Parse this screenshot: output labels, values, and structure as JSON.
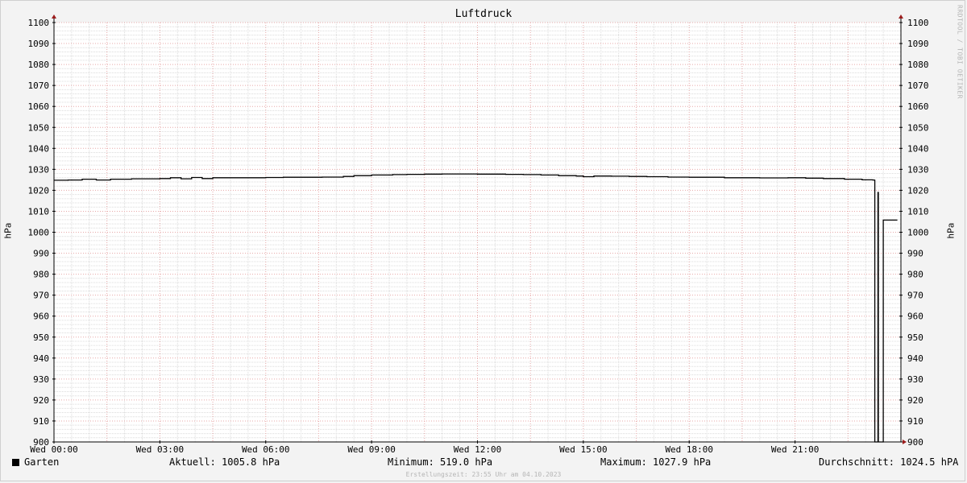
{
  "chart_data": {
    "type": "line",
    "title": "Luftdruck",
    "ylabel": "hPa",
    "ylim": [
      900,
      1100
    ],
    "y_major_step": 10,
    "y_minor_step": 2,
    "y_ticks": [
      900,
      910,
      920,
      930,
      940,
      950,
      960,
      970,
      980,
      990,
      1000,
      1010,
      1020,
      1030,
      1040,
      1050,
      1060,
      1070,
      1080,
      1090,
      1100
    ],
    "x_tick_labels": [
      "Wed 00:00",
      "Wed 03:00",
      "Wed 06:00",
      "Wed 09:00",
      "Wed 12:00",
      "Wed 15:00",
      "Wed 18:00",
      "Wed 21:00"
    ],
    "x_hours": [
      0,
      3,
      6,
      9,
      12,
      15,
      18,
      21
    ],
    "xlim_hours": [
      0,
      24
    ],
    "grid": true,
    "series": [
      {
        "name": "Garten",
        "color": "#000000",
        "x": [
          0,
          0.4,
          0.8,
          1.2,
          1.6,
          2.2,
          3,
          3.3,
          3.6,
          3.9,
          4.2,
          4.5,
          5,
          6,
          6.5,
          7,
          7.6,
          8.2,
          8.5,
          9,
          9.6,
          10,
          10.5,
          11,
          12,
          12.8,
          13.3,
          13.8,
          14.3,
          14.8,
          15,
          15.3,
          15.8,
          16.3,
          16.8,
          17.4,
          18,
          19,
          20,
          20.8,
          21.3,
          21.8,
          22.4,
          22.9,
          23.2,
          23.25,
          23.26,
          23.3,
          23.35,
          23.36,
          23.4,
          23.45,
          23.5,
          23.55,
          23.9
        ],
        "y": [
          1024.8,
          1024.9,
          1025.3,
          1024.9,
          1025.3,
          1025.5,
          1025.6,
          1026.0,
          1025.5,
          1026.1,
          1025.6,
          1026.0,
          1026.0,
          1026.1,
          1026.2,
          1026.2,
          1026.3,
          1026.6,
          1027.0,
          1027.3,
          1027.5,
          1027.6,
          1027.7,
          1027.8,
          1027.7,
          1027.6,
          1027.5,
          1027.3,
          1027.0,
          1026.8,
          1026.5,
          1026.8,
          1026.7,
          1026.6,
          1026.5,
          1026.3,
          1026.2,
          1026.0,
          1025.9,
          1026.0,
          1025.8,
          1025.6,
          1025.3,
          1025.0,
          1024.9,
          1024.8,
          900,
          900,
          1019.0,
          900,
          900,
          900,
          1005.8,
          1005.8,
          1005.8
        ]
      }
    ]
  },
  "legend": {
    "series_name": "Garten",
    "current": "Aktuell: 1005.8 hPa",
    "minimum": "Minimum: 519.0 hPa",
    "maximum": "Maximum: 1027.9 hPa",
    "average": "Durchschnitt: 1024.5 hPA"
  },
  "watermark": "RRDTOOL / TOBI OETIKER",
  "footer": "Erstellungszeit: 23:55 Uhr am 04.10.2023"
}
